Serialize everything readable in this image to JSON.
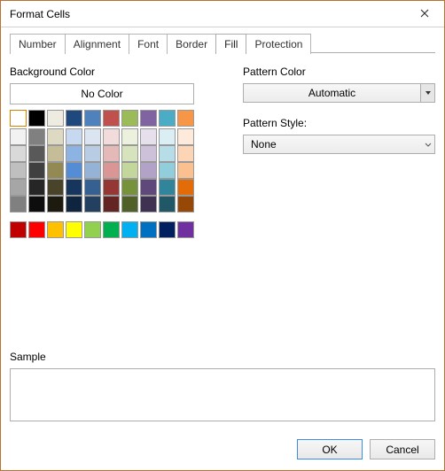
{
  "window": {
    "title": "Format Cells"
  },
  "tabs": [
    "Number",
    "Alignment",
    "Font",
    "Border",
    "Fill",
    "Protection"
  ],
  "active_tab_index": 4,
  "fill": {
    "bg_label": "Background Color",
    "no_color_label": "No Color",
    "pattern_color_label": "Pattern Color",
    "pattern_color_value": "Automatic",
    "pattern_style_label": "Pattern Style:",
    "pattern_style_value": "None",
    "sample_label": "Sample",
    "theme_row": [
      "#FFFFFF",
      "#000000",
      "#EEECE1",
      "#1F497D",
      "#4F81BD",
      "#C0504D",
      "#9BBB59",
      "#8064A2",
      "#4BACC6",
      "#F79646"
    ],
    "shade_grid": [
      [
        "#F2F2F2",
        "#808080",
        "#DDD9C3",
        "#C6D9F0",
        "#DBE5F1",
        "#F2DCDB",
        "#EBF1DD",
        "#E5E0EC",
        "#DBEEF3",
        "#FDEADA"
      ],
      [
        "#D9D9D9",
        "#595959",
        "#C4BD97",
        "#8DB3E2",
        "#B8CCE4",
        "#E5B9B7",
        "#D7E3BC",
        "#CCC1D9",
        "#B7DDE8",
        "#FBD5B5"
      ],
      [
        "#BFBFBF",
        "#404040",
        "#938953",
        "#548DD4",
        "#95B3D7",
        "#D99694",
        "#C3D69B",
        "#B2A2C7",
        "#92CDDC",
        "#FAC08F"
      ],
      [
        "#A6A6A6",
        "#262626",
        "#494429",
        "#17365D",
        "#366092",
        "#953734",
        "#76923C",
        "#5F497A",
        "#31859B",
        "#E36C09"
      ],
      [
        "#808080",
        "#0D0D0D",
        "#1D1B10",
        "#0F243E",
        "#244061",
        "#632423",
        "#4F6128",
        "#3F3151",
        "#205867",
        "#974806"
      ]
    ],
    "standard_row": [
      "#C00000",
      "#FF0000",
      "#FFC000",
      "#FFFF00",
      "#92D050",
      "#00B050",
      "#00B0F0",
      "#0070C0",
      "#002060",
      "#7030A0"
    ]
  },
  "buttons": {
    "ok": "OK",
    "cancel": "Cancel"
  }
}
